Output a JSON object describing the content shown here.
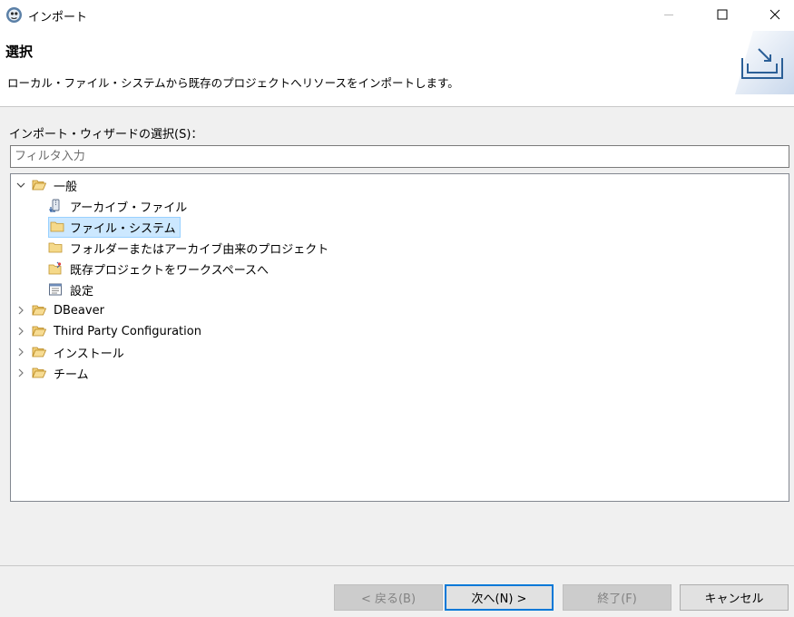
{
  "window": {
    "title": "インポート",
    "app_icon": "eclipse-icon"
  },
  "banner": {
    "title": "選択",
    "description": "ローカル・ファイル・システムから既存のプロジェクトへリソースをインポートします。",
    "image": "import-wizard-banner-icon"
  },
  "wizard": {
    "label": "インポート・ウィザードの選択(S)：",
    "filter_placeholder": "フィルタ入力",
    "filter_value": ""
  },
  "tree": {
    "items": [
      {
        "label": "一般",
        "expanded": true,
        "icon": "folder-open-icon"
      },
      {
        "label": "アーカイブ・ファイル",
        "icon": "archive-icon"
      },
      {
        "label": "ファイル・システム",
        "icon": "folder-icon",
        "selected": true
      },
      {
        "label": "フォルダーまたはアーカイブ由来のプロジェクト",
        "icon": "folder-icon"
      },
      {
        "label": "既存プロジェクトをワークスペースへ",
        "icon": "project-icon"
      },
      {
        "label": "設定",
        "icon": "preferences-icon"
      },
      {
        "label": "DBeaver",
        "expanded": false,
        "icon": "folder-open-icon"
      },
      {
        "label": "Third Party Configuration",
        "expanded": false,
        "icon": "folder-open-icon"
      },
      {
        "label": "インストール",
        "expanded": false,
        "icon": "folder-open-icon"
      },
      {
        "label": "チーム",
        "expanded": false,
        "icon": "folder-open-icon"
      }
    ]
  },
  "buttons": {
    "back": "< 戻る(B)",
    "next": "次へ(N) >",
    "finish": "終了(F)",
    "cancel": "キャンセル"
  },
  "colors": {
    "selection_bg": "#cce8ff",
    "selection_border": "#99d1ff",
    "default_button_border": "#0078d7",
    "folder_yellow": "#e8b84a"
  }
}
